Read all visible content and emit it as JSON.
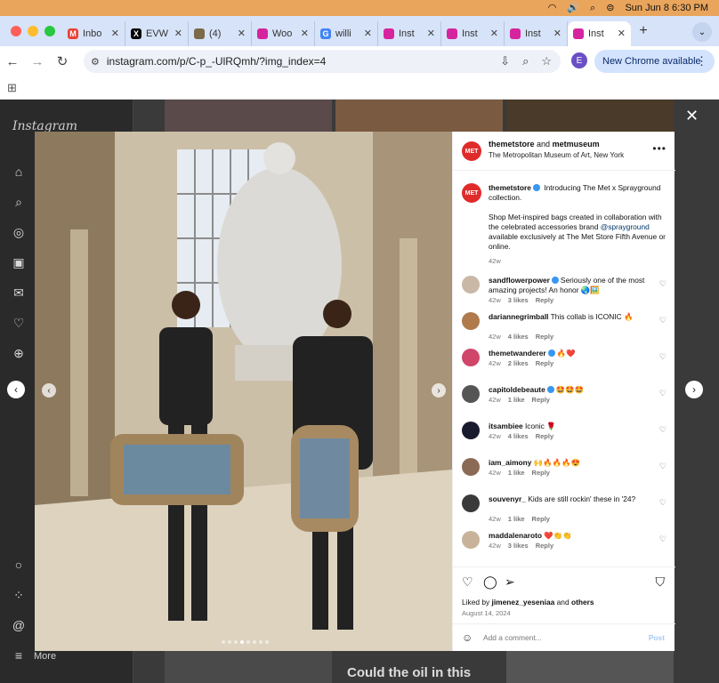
{
  "menubar": {
    "datetime": "Sun Jun 8  6:30 PM"
  },
  "tabs": [
    {
      "label": "Inbo",
      "favicon": "M",
      "color": "#ea4335"
    },
    {
      "label": "EVW",
      "favicon": "X",
      "color": "#000000"
    },
    {
      "label": "(4) ",
      "favicon": "",
      "color": "#7a6a4a"
    },
    {
      "label": "Woo",
      "favicon": "",
      "color": "#d6249f"
    },
    {
      "label": "willi",
      "favicon": "G",
      "color": "#4285f4"
    },
    {
      "label": "Inst",
      "favicon": "",
      "color": "#d6249f"
    },
    {
      "label": "Inst",
      "favicon": "",
      "color": "#d6249f"
    },
    {
      "label": "Inst",
      "favicon": "",
      "color": "#d6249f"
    },
    {
      "label": "Inst",
      "favicon": "",
      "color": "#d6249f"
    }
  ],
  "toolbar": {
    "url": "instagram.com/p/C-p_-UlRQmh/?img_index=4",
    "profile_initial": "E",
    "new_chrome_label": "New Chrome available"
  },
  "instagram": {
    "logo": "Instagram",
    "more_label": "More",
    "bg_caption": "Could the oil in this"
  },
  "post": {
    "author": "themetstore",
    "and_text": "and",
    "coauthor": "metmuseum",
    "location": "The Metropolitan Museum of Art, New York",
    "avatar_text": "MET",
    "caption_author": "themetstore",
    "caption_line1": "Introducing The Met x Sprayground collection.",
    "caption_line2a": "Shop Met-inspired bags created in collaboration with the celebrated accessories brand",
    "caption_mention": "@sprayground",
    "caption_line2b": "available exclusively at The Met Store Fifth Avenue or online.",
    "caption_age": "42w",
    "liked_prefix": "Liked by",
    "liked_user": "jimenez_yeseniaa",
    "liked_and": "and",
    "liked_others": "others",
    "date": "August 14, 2024",
    "add_comment_placeholder": "Add a comment...",
    "post_button": "Post"
  },
  "comments": [
    {
      "user": "sandflowerpower",
      "verified": true,
      "text": "Seriously one of the most amazing projects! An honor 🌏🖼️",
      "age": "42w",
      "likes": "3 likes",
      "reply": "Reply",
      "avatar_color": "#c9b8a6"
    },
    {
      "user": "dariannegrimball",
      "verified": false,
      "text": "This collab is ICONIC 🔥",
      "age": "42w",
      "likes": "4 likes",
      "reply": "Reply",
      "avatar_color": "#b07a4c"
    },
    {
      "user": "themetwanderer",
      "verified": true,
      "text": "🔥❤️",
      "age": "42w",
      "likes": "2 likes",
      "reply": "Reply",
      "avatar_color": "#d0456a"
    },
    {
      "user": "capitoldebeaute",
      "verified": true,
      "text": "🤩🤩🤩",
      "age": "42w",
      "likes": "1 like",
      "reply": "Reply",
      "avatar_color": "#555555"
    },
    {
      "user": "itsambiee",
      "verified": false,
      "text": "Iconic 🌹",
      "age": "42w",
      "likes": "4 likes",
      "reply": "Reply",
      "avatar_color": "#1a1a2e"
    },
    {
      "user": "iam_aimony",
      "verified": false,
      "text": "🙌🔥🔥🔥😍",
      "age": "42w",
      "likes": "1 like",
      "reply": "Reply",
      "avatar_color": "#8a6a55"
    },
    {
      "user": "souvenyr_",
      "verified": false,
      "text": "Kids are still rockin' these in '24?",
      "age": "42w",
      "likes": "1 like",
      "reply": "Reply",
      "avatar_color": "#3a3a3a"
    },
    {
      "user": "maddalenaroto",
      "verified": false,
      "text": "❤️👏👏",
      "age": "42w",
      "likes": "3 likes",
      "reply": "Reply",
      "avatar_color": "#c8b39a"
    }
  ],
  "carousel": {
    "count": 8,
    "current": 4
  },
  "colors": {
    "accent": "#3897f0",
    "menubar": "#e9a55c",
    "chrome_frame": "#d7e3f8"
  }
}
